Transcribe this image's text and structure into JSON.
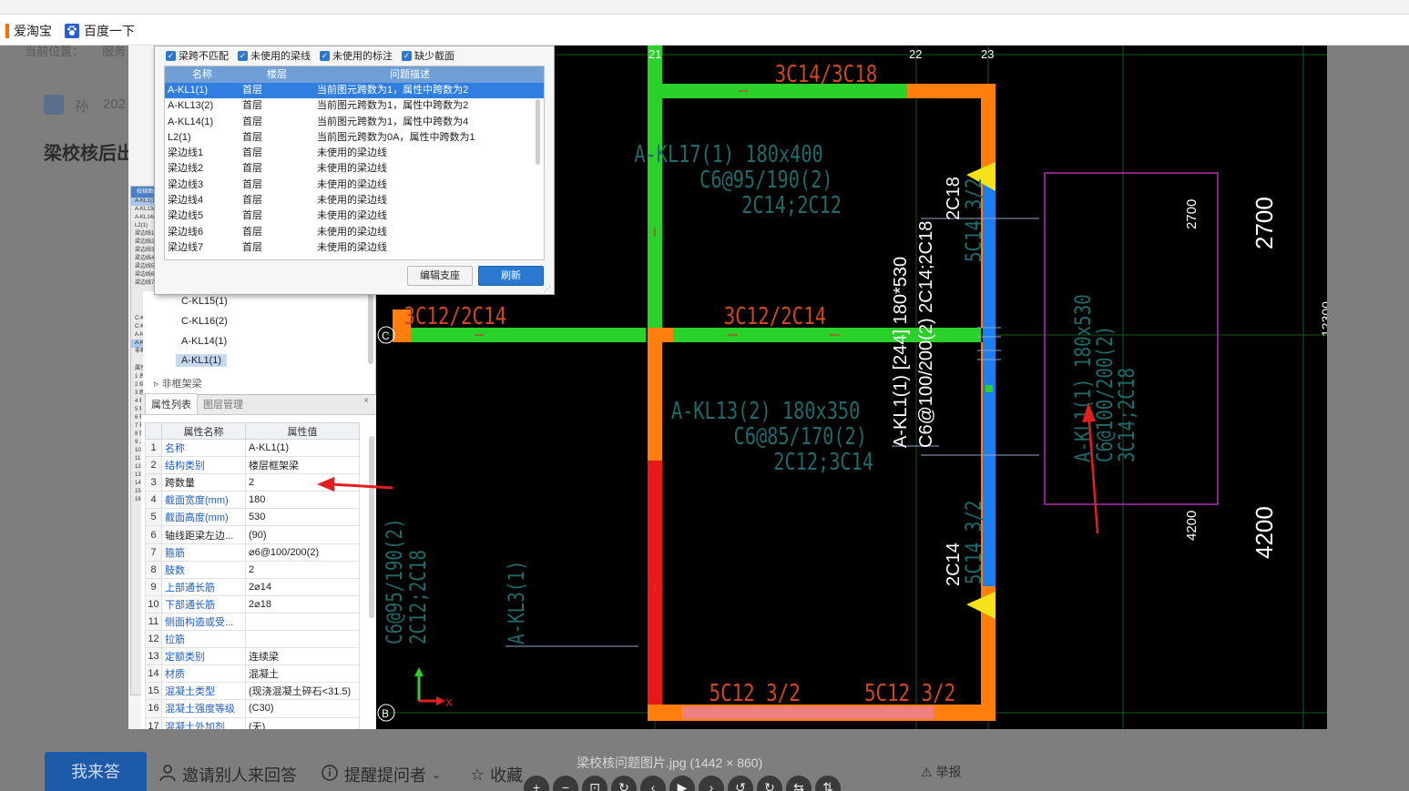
{
  "bookmarks": [
    {
      "label": "爱淘宝",
      "icon": "taobao-icon"
    },
    {
      "label": "百度一下",
      "icon": "baidu-paw-icon"
    }
  ],
  "page": {
    "breadcrumb_prefix": "当前位置：",
    "breadcrumb_item": "服务",
    "author_name": "孙",
    "date_fragment": "202",
    "question_title": "梁校核后出",
    "answer_button": "我来答",
    "invite_label": "邀请别人来回答",
    "remind_label": "提醒提问者",
    "favorite_label": "收藏",
    "report_label": "举报",
    "image_caption": "梁校核问题图片.jpg (1442 × 860)"
  },
  "dialog": {
    "checks": [
      "梁跨不匹配",
      "未使用的梁线",
      "未使用的标注",
      "缺少截面"
    ],
    "columns": [
      "名称",
      "楼层",
      "问题描述"
    ],
    "rows": [
      {
        "name": "A-KL1(1)",
        "floor": "首层",
        "desc": "当前图元跨数为1，属性中跨数为2"
      },
      {
        "name": "A-KL13(2)",
        "floor": "首层",
        "desc": "当前图元跨数为1，属性中跨数为2"
      },
      {
        "name": "A-KL14(1)",
        "floor": "首层",
        "desc": "当前图元跨数为1，属性中跨数为4"
      },
      {
        "name": "L2(1)",
        "floor": "首层",
        "desc": "当前图元跨数为0A，属性中跨数为1"
      },
      {
        "name": "梁边线1",
        "floor": "首层",
        "desc": "未使用的梁边线"
      },
      {
        "name": "梁边线2",
        "floor": "首层",
        "desc": "未使用的梁边线"
      },
      {
        "name": "梁边线3",
        "floor": "首层",
        "desc": "未使用的梁边线"
      },
      {
        "name": "梁边线4",
        "floor": "首层",
        "desc": "未使用的梁边线"
      },
      {
        "name": "梁边线5",
        "floor": "首层",
        "desc": "未使用的梁边线"
      },
      {
        "name": "梁边线6",
        "floor": "首层",
        "desc": "未使用的梁边线"
      },
      {
        "name": "梁边线7",
        "floor": "首层",
        "desc": "未使用的梁边线"
      }
    ],
    "btn_edit": "编辑支座",
    "btn_refresh": "刷新"
  },
  "tree": {
    "items": [
      "C-KL15(1)",
      "C-KL16(2)",
      "A-KL14(1)",
      "A-KL1(1)"
    ],
    "group": "非框架梁"
  },
  "props": {
    "tabs": [
      "属性列表",
      "图层管理"
    ],
    "col_name": "属性名称",
    "col_value": "属性值",
    "rows": [
      {
        "n": "1",
        "name": "名称",
        "value": "A-KL1(1)",
        "blue": true
      },
      {
        "n": "2",
        "name": "结构类别",
        "value": "楼层框架梁",
        "blue": true
      },
      {
        "n": "3",
        "name": "跨数量",
        "value": "2",
        "blue": false
      },
      {
        "n": "4",
        "name": "截面宽度(mm)",
        "value": "180",
        "blue": true
      },
      {
        "n": "5",
        "name": "截面高度(mm)",
        "value": "530",
        "blue": true
      },
      {
        "n": "6",
        "name": "轴线距梁左边...",
        "value": "(90)",
        "blue": false
      },
      {
        "n": "7",
        "name": "箍筋",
        "value": "⌀6@100/200(2)",
        "blue": true
      },
      {
        "n": "8",
        "name": "肢数",
        "value": "2",
        "blue": true
      },
      {
        "n": "9",
        "name": "上部通长筋",
        "value": "2⌀14",
        "blue": true
      },
      {
        "n": "10",
        "name": "下部通长筋",
        "value": "2⌀18",
        "blue": true
      },
      {
        "n": "11",
        "name": "侧面构造或受...",
        "value": "",
        "blue": true
      },
      {
        "n": "12",
        "name": "拉筋",
        "value": "",
        "blue": true
      },
      {
        "n": "13",
        "name": "定额类别",
        "value": "连续梁",
        "blue": true
      },
      {
        "n": "14",
        "name": "材质",
        "value": "混凝土",
        "blue": true
      },
      {
        "n": "15",
        "name": "混凝土类型",
        "value": "(现浇混凝土碎石<31.5)",
        "blue": true
      },
      {
        "n": "16",
        "name": "混凝土强度等级",
        "value": "(C30)",
        "blue": true
      },
      {
        "n": "17",
        "name": "混凝土外加剂",
        "value": "(无)",
        "blue": true
      }
    ]
  },
  "mini": {
    "tabs": "属性列表  图层管理",
    "rows": [
      "A-KL1(1)",
      "A-KL13(2)",
      "A-KL14(1)",
      "L2(1)",
      "梁边线1",
      "梁边线2",
      "梁边线3",
      "梁边线4",
      "梁边线5",
      "梁边线6",
      "梁边线7"
    ],
    "tree": [
      "C-KL15(1)",
      "C-KL16(2)",
      "A-KL14(1)",
      "A-KL1(1)",
      "非框架梁"
    ],
    "props": [
      "1 名称",
      "2 结构类别",
      "3 跨数量",
      "4 截面宽度(mm)",
      "5 截面高度(mm)",
      "6 轴线距梁左边...",
      "7 箍筋",
      "8 肢数",
      "9 上部通长筋",
      "10 下部通长筋",
      "11 侧面构造或受...",
      "12 拉筋",
      "13 定额类别",
      "14 材质",
      "15 混凝土类型",
      "16 混凝土强度等级"
    ]
  },
  "cad": {
    "axis_21": "21",
    "axis_22": "22",
    "axis_23": "23",
    "axis_c": "C",
    "axis_b": "B",
    "lbl_top": "3C14/3C18",
    "lbl_kl17_a": "A-KL17(1) 180x400",
    "lbl_kl17_b": "C6@95/190(2)",
    "lbl_kl17_c": "2C14;2C12",
    "lbl_mid_left": "3C12/2C14",
    "lbl_mid_right": "3C12/2C14",
    "lbl_kl13_a": "A-KL13(2) 180x350",
    "lbl_kl13_b": "C6@85/170(2)",
    "lbl_kl13_c": "2C12;3C14",
    "lbl_bot_left": "5C12 3/2",
    "lbl_bot_right": "5C12 3/2",
    "lbl_kl1_a": "A-KL1(1) [244] 180*530",
    "lbl_kl1_b": "C6@100/200(2) 2C14;2C18",
    "lbl_2c18": "2C18",
    "lbl_5c14a": "5C14 3/2",
    "lbl_2c14": "2C14",
    "lbl_5c14b": "5C14 3/2",
    "lbl_left_a": "C6@95/190(2)",
    "lbl_left_b": "2C12;2C18",
    "lbl_kl3": "A-KL3(1)",
    "lbl_rot_a": "A-KL1(1) 180x530",
    "lbl_rot_b": "C6@100/200(2)",
    "lbl_rot_c": "3C14;2C18",
    "dim_2700_s": "2700",
    "dim_2700_l": "2700",
    "dim_4200_s": "4200",
    "dim_4200_l": "4200",
    "dim_edge": "12300",
    "ucs_x": "X"
  }
}
